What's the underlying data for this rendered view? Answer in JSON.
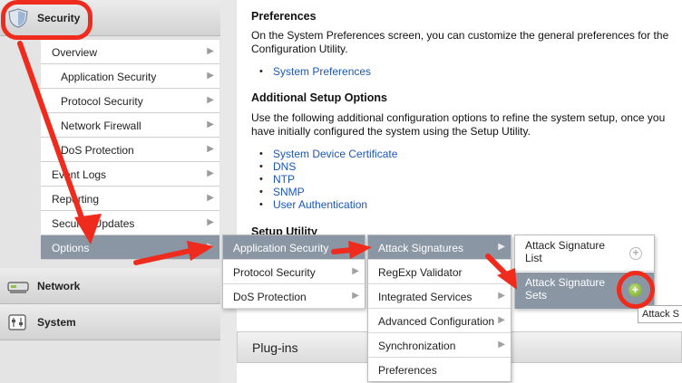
{
  "sidebar": {
    "sections": [
      {
        "label": "Security",
        "icon": "shield-icon"
      },
      {
        "label": "Network",
        "icon": "network-device-icon"
      },
      {
        "label": "System",
        "icon": "system-sliders-icon"
      }
    ],
    "security_items": [
      {
        "label": "Overview"
      },
      {
        "label": "Application Security"
      },
      {
        "label": "Protocol Security"
      },
      {
        "label": "Network Firewall"
      },
      {
        "label": "DoS Protection"
      },
      {
        "label": "Event Logs"
      },
      {
        "label": "Reporting"
      },
      {
        "label": "Security Updates"
      },
      {
        "label": "Options"
      }
    ]
  },
  "main": {
    "preferences": {
      "heading": "Preferences",
      "text": "On the System Preferences screen, you can customize the general preferences for the Configuration Utility.",
      "links": [
        "System Preferences"
      ]
    },
    "additional": {
      "heading": "Additional Setup Options",
      "text": "Use the following additional configuration options to refine the system setup, once you have initially configured the system using the Setup Utility.",
      "links": [
        "System Device Certificate",
        "DNS",
        "NTP",
        "SNMP",
        "User Authentication"
      ]
    },
    "setup_utility_heading": "Setup Utility",
    "plugins_heading": "Plug-ins"
  },
  "flyouts": {
    "options_menu": [
      "Application Security",
      "Protocol Security",
      "DoS Protection"
    ],
    "application_security_menu": [
      "Attack Signatures",
      "RegExp Validator",
      "Integrated Services",
      "Advanced Configuration",
      "Synchronization",
      "Preferences"
    ],
    "attack_signatures_menu": [
      "Attack Signature List",
      "Attack Signature Sets"
    ]
  },
  "tooltip": "Attack S",
  "colors": {
    "highlight": "#ef2b1e",
    "selected_menu": "#8a96a4",
    "link": "#1a57b8",
    "add_button_green": "#6ea320"
  }
}
